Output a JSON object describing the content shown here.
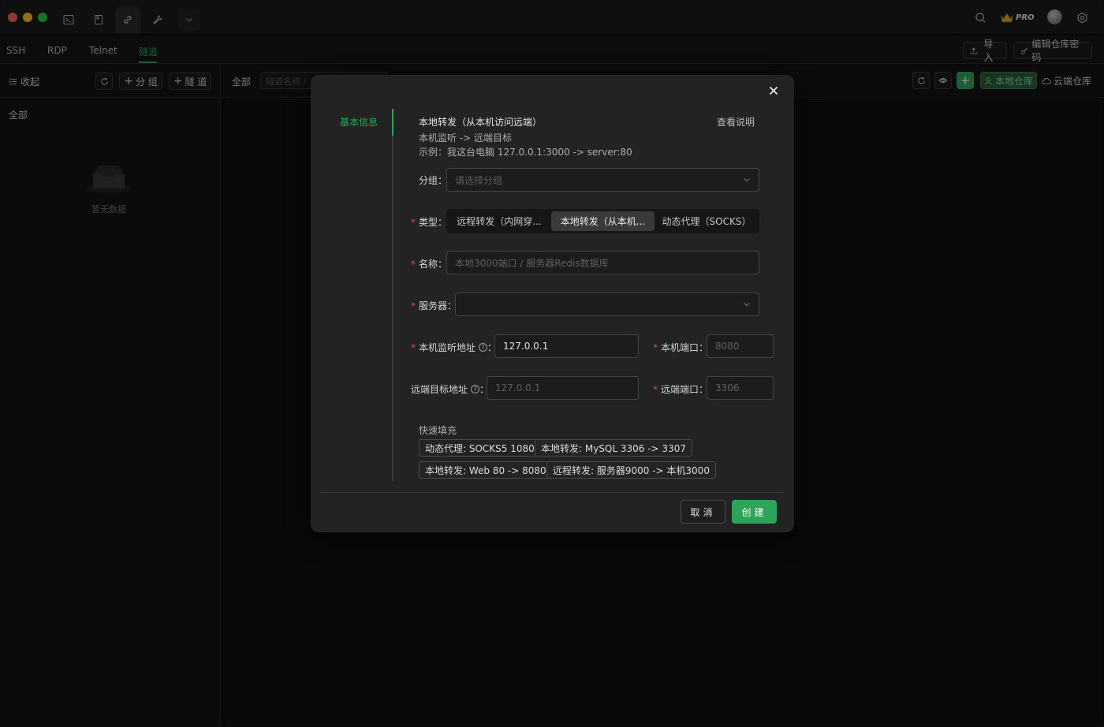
{
  "titlebar": {
    "pro_label": "PRO"
  },
  "protocol_tabs": [
    {
      "label": "SSH"
    },
    {
      "label": "RDP"
    },
    {
      "label": "Telnet"
    },
    {
      "label": "隧道",
      "active": true
    }
  ],
  "topbar": {
    "import_label": "导入",
    "edit_repo_password_label": "编辑仓库密码"
  },
  "sidebar": {
    "collapse_label": "收起",
    "add_group_label": "分 组",
    "add_tunnel_label": "隧 道",
    "all_label": "全部",
    "empty_text": "暂无数据"
  },
  "main_header": {
    "all_label": "全部",
    "search_placeholder": "隧道名称 /",
    "local_repo_label": "本地仓库",
    "cloud_repo_label": "云端仓库"
  },
  "modal": {
    "nav_item": "基本信息",
    "title": "本地转发（从本机访问远端）",
    "help_link": "查看说明",
    "subtitle": "本机监听  ->  远端目标",
    "example": "示例：我这台电脑 127.0.0.1:3000 -> server:80",
    "group": {
      "label": "分组",
      "placeholder": "请选择分组"
    },
    "type": {
      "label": "类型",
      "options": [
        {
          "label": "远程转发（内网穿..."
        },
        {
          "label": "本地转发（从本机...",
          "active": true
        },
        {
          "label": "动态代理（SOCKS）"
        }
      ]
    },
    "name": {
      "label": "名称",
      "placeholder": "本地3000端口 / 服务器Redis数据库"
    },
    "server": {
      "label": "服务器",
      "value": ""
    },
    "local_address": {
      "label": "本机监听地址",
      "value": "127.0.0.1"
    },
    "local_port": {
      "label": "本机端口",
      "placeholder": "8080"
    },
    "remote_address": {
      "label": "远端目标地址",
      "placeholder": "127.0.0.1"
    },
    "remote_port": {
      "label": "远端端口",
      "placeholder": "3306"
    },
    "quick_fill": {
      "label": "快速填充",
      "presets": [
        {
          "label": "动态代理: SOCKS5 1080"
        },
        {
          "label": "本地转发: MySQL 3306 -> 3307"
        },
        {
          "label": "本地转发: Web 80 -> 8080"
        },
        {
          "label": "远程转发: 服务器9000 -> 本机3000"
        }
      ]
    },
    "cancel_label": "取消",
    "create_label": "创建"
  },
  "colors": {
    "accent": "#2ea35a",
    "required": "#e04848",
    "background": "#0e0e0e",
    "modal_bg": "#232323"
  }
}
